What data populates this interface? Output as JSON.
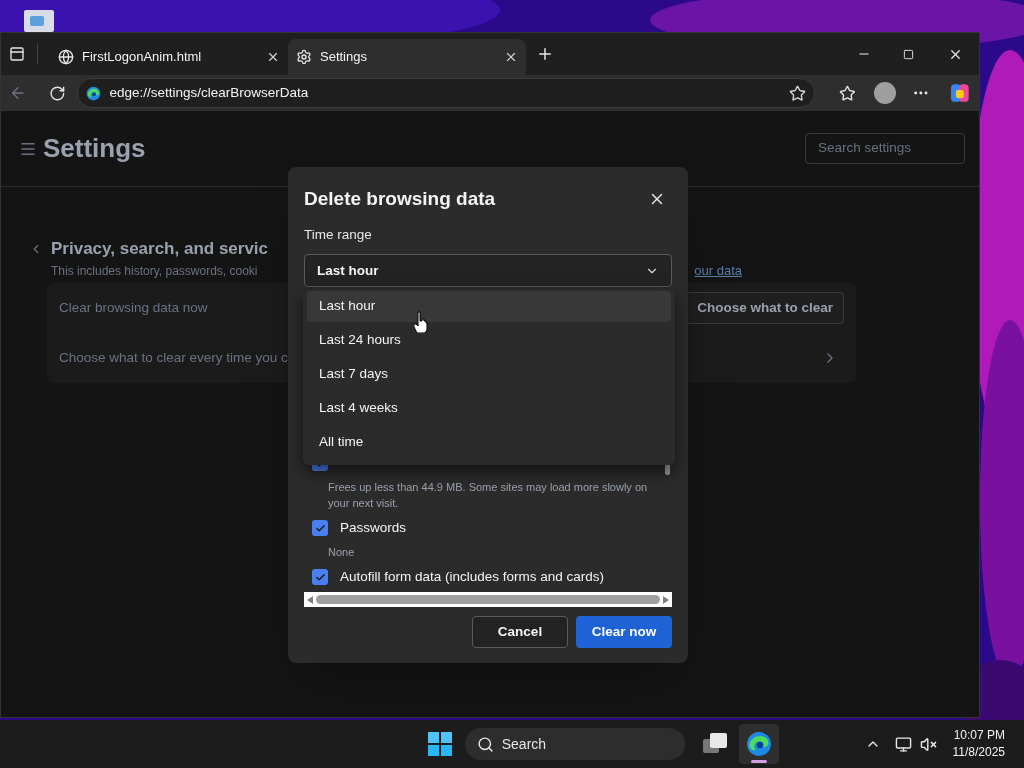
{
  "browser": {
    "tabs": [
      {
        "title": "FirstLogonAnim.html",
        "kind": "web-page",
        "selected": false
      },
      {
        "title": "Settings",
        "kind": "settings",
        "selected": true
      }
    ],
    "address": "edge://settings/clearBrowserData"
  },
  "settings": {
    "title": "Settings",
    "search_placeholder": "Search settings",
    "section_title": "Privacy, search, and servic",
    "section_description": "This includes history, passwords, cooki",
    "link": "our data",
    "rows": [
      {
        "label": "Clear browsing data now",
        "button": "Choose what to clear"
      },
      {
        "label": "Choose what to clear every time you c"
      }
    ]
  },
  "dialog": {
    "title": "Delete browsing data",
    "time_range_label": "Time range",
    "time_range_value": "Last hour",
    "options": [
      {
        "label": "Last hour",
        "selected": true
      },
      {
        "label": "Last 24 hours",
        "selected": false
      },
      {
        "label": "Last 7 days",
        "selected": false
      },
      {
        "label": "Last 4 weeks",
        "selected": false
      },
      {
        "label": "All time",
        "selected": false
      }
    ],
    "items": [
      {
        "checked": true,
        "description": "Frees up less than 44.9 MB. Some sites may load more slowly on your next visit."
      },
      {
        "label": "Passwords",
        "checked": true,
        "description": "None"
      },
      {
        "label": "Autofill form data (includes forms and cards)",
        "checked": true
      }
    ],
    "buttons": [
      {
        "label": "Cancel",
        "kind": "secondary"
      },
      {
        "label": "Clear now",
        "kind": "primary"
      }
    ]
  },
  "taskbar": {
    "search": "Search",
    "time": "10:07 PM",
    "date": "11/8/2025",
    "apps": [
      {
        "kind": "task-view",
        "active": false
      },
      {
        "kind": "edge",
        "active": true
      }
    ]
  }
}
